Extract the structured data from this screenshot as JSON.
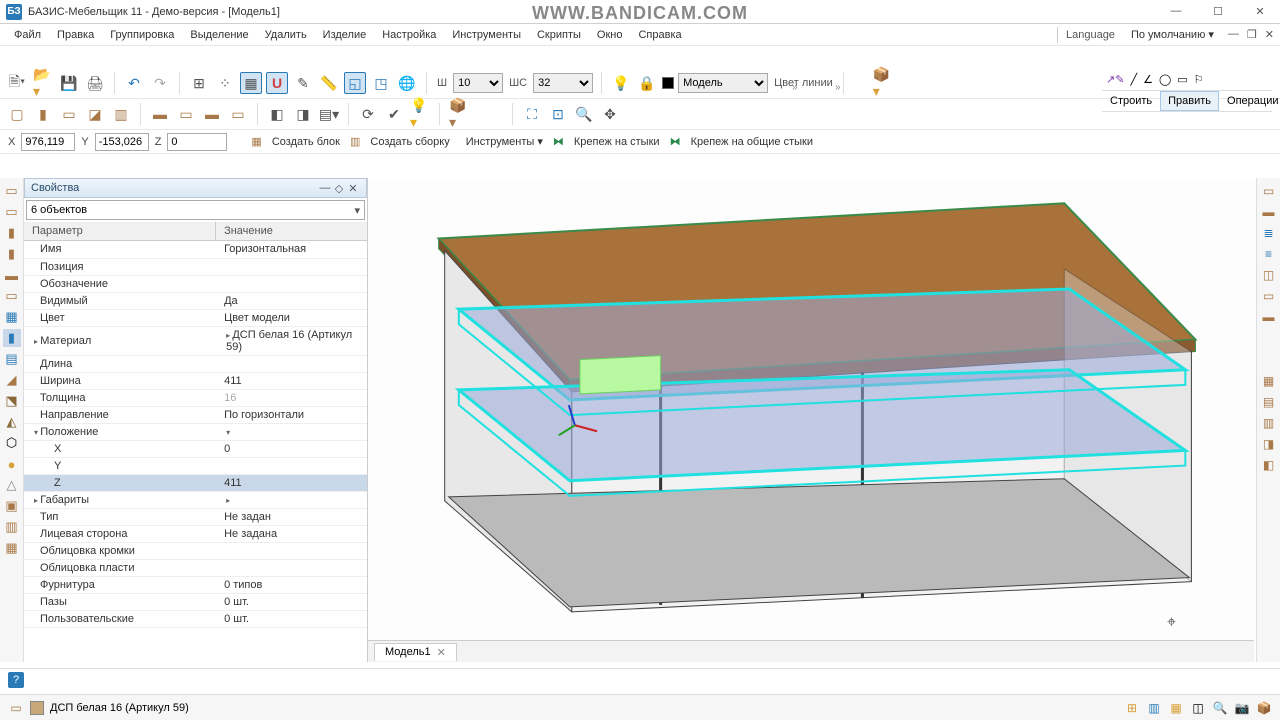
{
  "titlebar": {
    "app_icon": "БЗ",
    "title": "БАЗИС-Мебельщик 11 - Демо-версия - [Модель1]"
  },
  "watermark": "WWW.BANDICAM.COM",
  "menu": {
    "items": [
      "Файл",
      "Правка",
      "Группировка",
      "Выделение",
      "Удалить",
      "Изделие",
      "Настройка",
      "Инструменты",
      "Скрипты",
      "Окно",
      "Справка"
    ],
    "language_label": "Language",
    "language_value": "По умолчанию"
  },
  "tool1": {
    "w_label": "Ш",
    "w_value": "10",
    "ws_label": "ШС",
    "ws_value": "32",
    "model_label": "Модель",
    "line_color_label": "Цвет линии"
  },
  "rightgroup": {
    "tabs": [
      "Строить",
      "Править",
      "Операции"
    ],
    "selected": 1
  },
  "coords": {
    "x_label": "X",
    "x": "976,119",
    "y_label": "Y",
    "y": "-153,026",
    "z_label": "Z",
    "z": "0",
    "menu": [
      "Создать блок",
      "Создать сборку",
      "Инструменты",
      "Крепеж на стыки",
      "Крепеж на общие стыки"
    ]
  },
  "props": {
    "title": "Свойства",
    "combo": "6 объектов",
    "col_param": "Параметр",
    "col_value": "Значение",
    "rows": [
      {
        "k": "Имя",
        "v": "Горизонтальная"
      },
      {
        "k": "Позиция",
        "v": ""
      },
      {
        "k": "Обозначение",
        "v": ""
      },
      {
        "k": "Видимый",
        "v": "Да"
      },
      {
        "k": "Цвет",
        "v": "Цвет модели"
      },
      {
        "k": "Материал",
        "v": "ДСП белая 16 (Артикул 59)",
        "group": true,
        "open": false
      },
      {
        "k": "Длина",
        "v": ""
      },
      {
        "k": "Ширина",
        "v": "411"
      },
      {
        "k": "Толщина",
        "v": "16",
        "dim": true
      },
      {
        "k": "Направление",
        "v": "По горизонтали"
      },
      {
        "k": "Положение",
        "v": "",
        "group": true,
        "open": true
      },
      {
        "k": "X",
        "v": "0",
        "indent": true
      },
      {
        "k": "Y",
        "v": "",
        "indent": true
      },
      {
        "k": "Z",
        "v": "411",
        "indent": true,
        "selected": true
      },
      {
        "k": "Габариты",
        "v": "",
        "group": true
      },
      {
        "k": "Тип",
        "v": "Не задан"
      },
      {
        "k": "Лицевая сторона",
        "v": "Не задана"
      },
      {
        "k": "Облицовка кромки",
        "v": ""
      },
      {
        "k": "Облицовка пласти",
        "v": ""
      },
      {
        "k": "Фурнитура",
        "v": "0 типов"
      },
      {
        "k": "Пазы",
        "v": "0 шт."
      },
      {
        "k": "Пользовательские",
        "v": "0 шт."
      }
    ]
  },
  "vptab": {
    "name": "Модель1"
  },
  "statusbar": {
    "material": "ДСП белая 16 (Артикул 59)"
  }
}
